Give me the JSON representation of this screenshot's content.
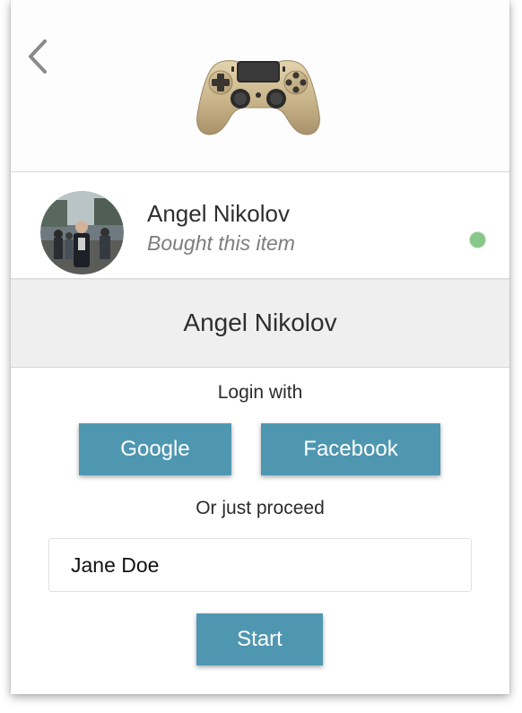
{
  "buyer": {
    "name": "Angel Nikolov",
    "subtitle": "Bought this item"
  },
  "selected_name": "Angel Nikolov",
  "login": {
    "label": "Login with",
    "google_label": "Google",
    "facebook_label": "Facebook",
    "proceed_label": "Or just proceed"
  },
  "name_input": {
    "value": "Jane Doe"
  },
  "start_label": "Start",
  "icons": {
    "back": "chevron-left-icon",
    "product": "gamepad-controller-image",
    "status": "online-dot"
  },
  "colors": {
    "button": "#4f97b1",
    "status_online": "#88c78a",
    "name_bar": "#efefef"
  }
}
